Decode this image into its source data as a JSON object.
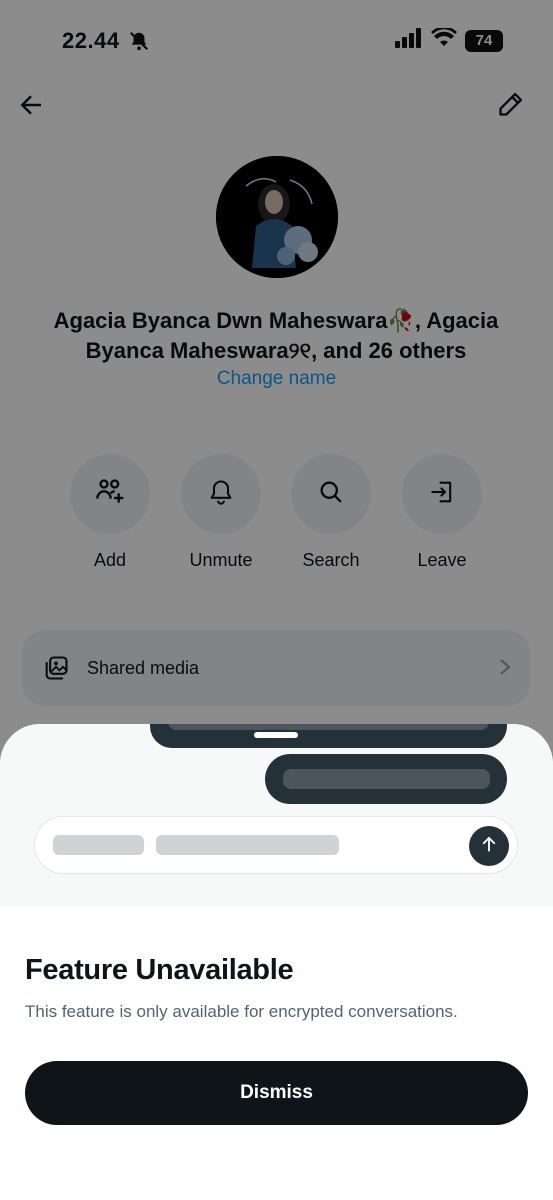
{
  "status_bar": {
    "time": "22.44",
    "battery": "74"
  },
  "group": {
    "name": "Agacia Byanca Dwn Maheswara🥀, Agacia Byanca Maheswara୨୧, and 26 others",
    "change_name_label": "Change name"
  },
  "actions": [
    {
      "label": "Add",
      "icon": "add-people-icon"
    },
    {
      "label": "Unmute",
      "icon": "bell-icon"
    },
    {
      "label": "Search",
      "icon": "search-icon"
    },
    {
      "label": "Leave",
      "icon": "leave-icon"
    }
  ],
  "shared_media": {
    "label": "Shared media",
    "icon": "media-gallery-icon"
  },
  "sheet": {
    "title": "Feature Unavailable",
    "description": "This feature is only available for encrypted conversations.",
    "dismiss_label": "Dismiss"
  },
  "colors": {
    "accent": "#1d9bf0",
    "primary_button": "#0f1419",
    "bubble": "#253139",
    "secondary_text": "#536471"
  }
}
